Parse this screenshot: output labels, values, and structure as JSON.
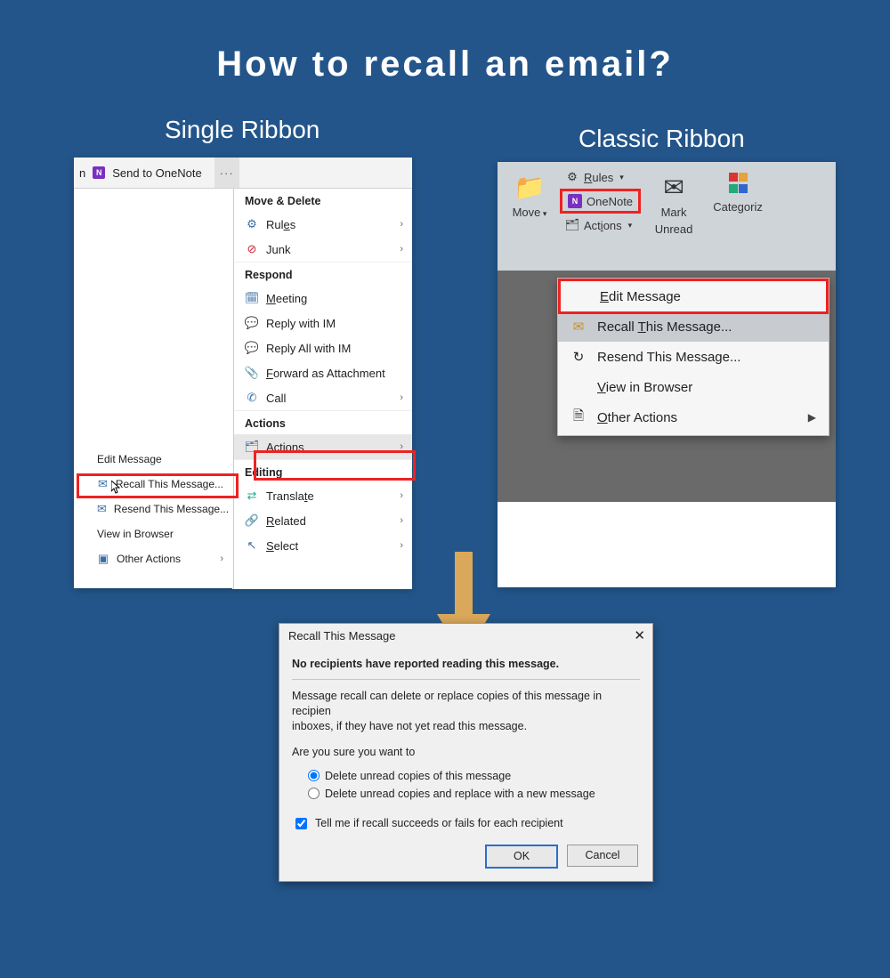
{
  "page": {
    "title": "How to recall an email?",
    "captions": {
      "left": "Single Ribbon",
      "right": "Classic Ribbon"
    }
  },
  "single": {
    "ribbon": {
      "sendToOneNote": "Send to OneNote",
      "more": "···",
      "letter": "n"
    },
    "sections": {
      "moveDelete": "Move & Delete",
      "respond": "Respond",
      "actions": "Actions",
      "editing": "Editing"
    },
    "menu": {
      "rules": "Rules",
      "junk": "Junk",
      "meeting": "Meeting",
      "replyIM": "Reply with IM",
      "replyAllIM": "Reply All with IM",
      "forwardAttach": "Forward as Attachment",
      "call": "Call",
      "actions": "Actions",
      "translate": "Translate",
      "related": "Related",
      "select": "Select"
    },
    "submenu": {
      "editMessage": "Edit Message",
      "recall": "Recall This Message...",
      "resend": "Resend This Message...",
      "viewBrowser": "View in Browser",
      "otherActions": "Other Actions"
    }
  },
  "classic": {
    "ribbon": {
      "move": "Move",
      "rules": "Rules",
      "onenote": "OneNote",
      "actions": "Actions",
      "markUnread": {
        "l1": "Mark",
        "l2": "Unread"
      },
      "categorize": "Categoriz"
    },
    "dropdown": {
      "editMessage": "Edit Message",
      "recall": "Recall This Message...",
      "resend": "Resend This Message...",
      "viewBrowser": "View in Browser",
      "otherActions": "Other Actions"
    }
  },
  "dialog": {
    "title": "Recall This Message",
    "heading": "No recipients have reported reading this message.",
    "body1": "Message recall can delete or replace copies of this message in recipien",
    "body2": "inboxes, if they have not yet read this message.",
    "prompt": "Are you sure you want to",
    "opt1": "Delete unread copies of this message",
    "opt2": "Delete unread copies and replace with a new message",
    "check": "Tell me if recall succeeds or fails for each recipient",
    "ok": "OK",
    "cancel": "Cancel"
  }
}
